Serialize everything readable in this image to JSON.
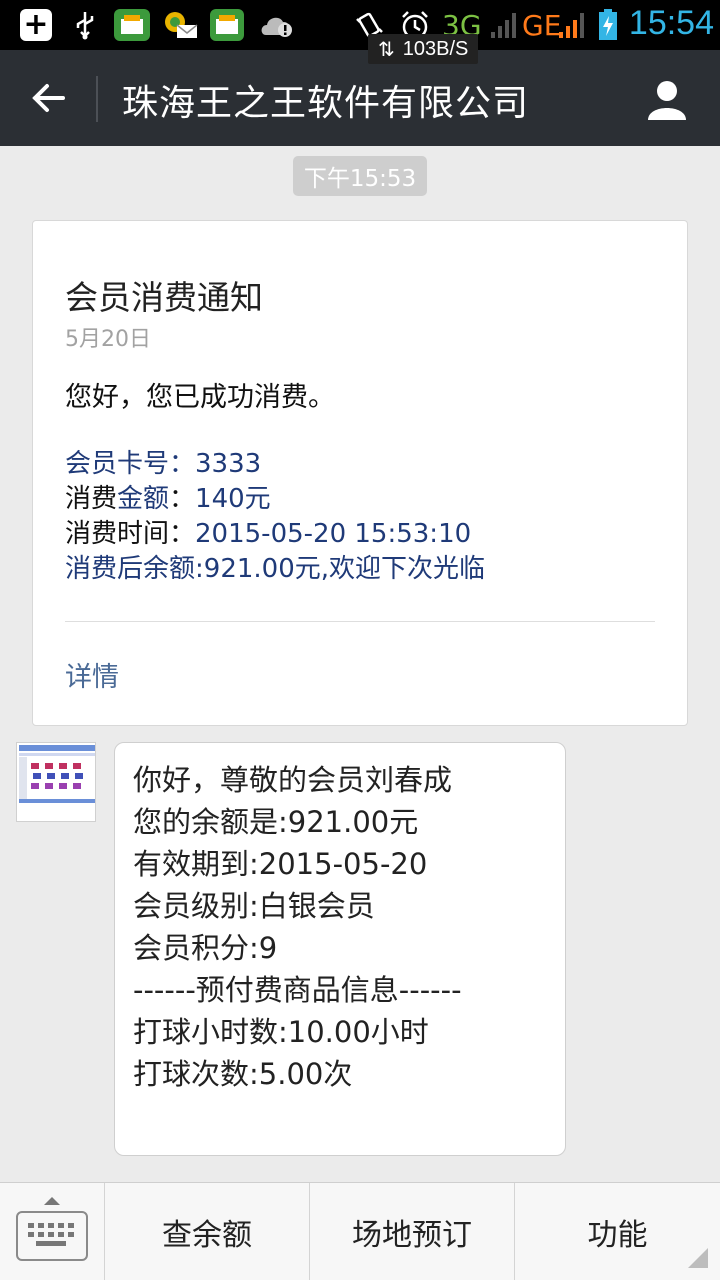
{
  "status_bar": {
    "time": "15:54",
    "net_speed": "103B/S",
    "network_3g": "3G",
    "network_ge": "GE",
    "icons": [
      "add-icon",
      "usb-icon",
      "app-icon",
      "app-message-icon",
      "app-icon",
      "cloud-alert-icon",
      "vibrate-icon",
      "alarm-icon",
      "signal-icon",
      "battery-charging-icon"
    ]
  },
  "header": {
    "title": "珠海王之王软件有限公司",
    "back_icon": "back-arrow-icon",
    "profile_icon": "profile-icon"
  },
  "chat": {
    "timestamp": "下午15:53",
    "card": {
      "title": "会员消费通知",
      "date": "5月20日",
      "greeting": "您好，您已成功消费。",
      "fields": [
        {
          "label": "会员卡号：",
          "value": "3333"
        },
        {
          "label": "消费",
          "label_highlight": "金额",
          "label_tail": "：",
          "value": "140元"
        },
        {
          "label": "消费时间：",
          "value": "2015-05-20 15:53:10"
        },
        {
          "label": "消费后余额",
          "value": ":921.00元,欢迎下次光临"
        }
      ],
      "detail_link": "详情"
    },
    "reply": {
      "lines": [
        "你好，尊敬的会员刘春成",
        "您的余额是:921.00元",
        "有效期到:2015-05-20",
        "会员级别:白银会员",
        "会员积分:9",
        "------预付费商品信息------",
        "打球小时数:10.00小时",
        "打球次数:5.00次"
      ]
    }
  },
  "bottom_menu": {
    "keyboard_icon": "keyboard-icon",
    "items": [
      "查余额",
      "场地预订",
      "功能"
    ]
  },
  "colors": {
    "header_bg": "#2b2f34",
    "chat_bg": "#ebebeb",
    "accent_blue": "#1f3a78",
    "link_blue": "#4a6a96",
    "time_blue": "#33b5e5"
  }
}
